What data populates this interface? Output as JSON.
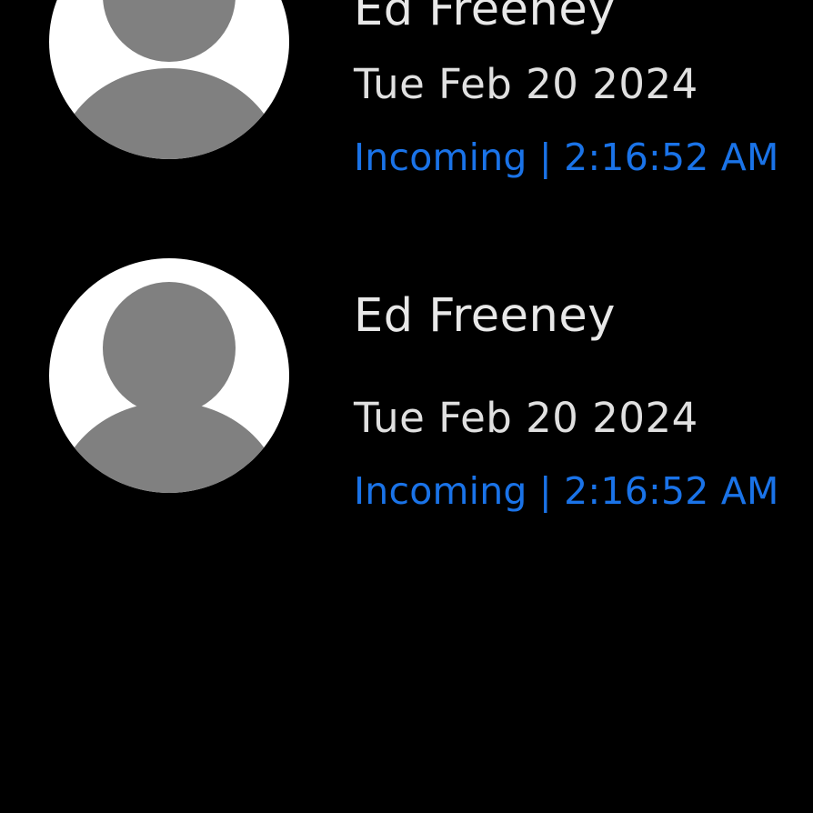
{
  "theme": {
    "background": "#000000",
    "name_color": "#e8e8e8",
    "date_color": "#e0e0e0",
    "accent": "#1a73e8",
    "avatar_bg": "#ffffff",
    "avatar_fg": "#808080"
  },
  "call_log": {
    "items": [
      {
        "name": "Ed Freeney",
        "date": "Tue Feb 20 2024",
        "status": "Incoming | 2:16:52 AM",
        "avatar_icon": "default-person-icon"
      },
      {
        "name": "Ed Freeney",
        "date": "Tue Feb 20 2024",
        "status": "Incoming | 2:16:52 AM",
        "avatar_icon": "default-person-icon"
      }
    ]
  }
}
